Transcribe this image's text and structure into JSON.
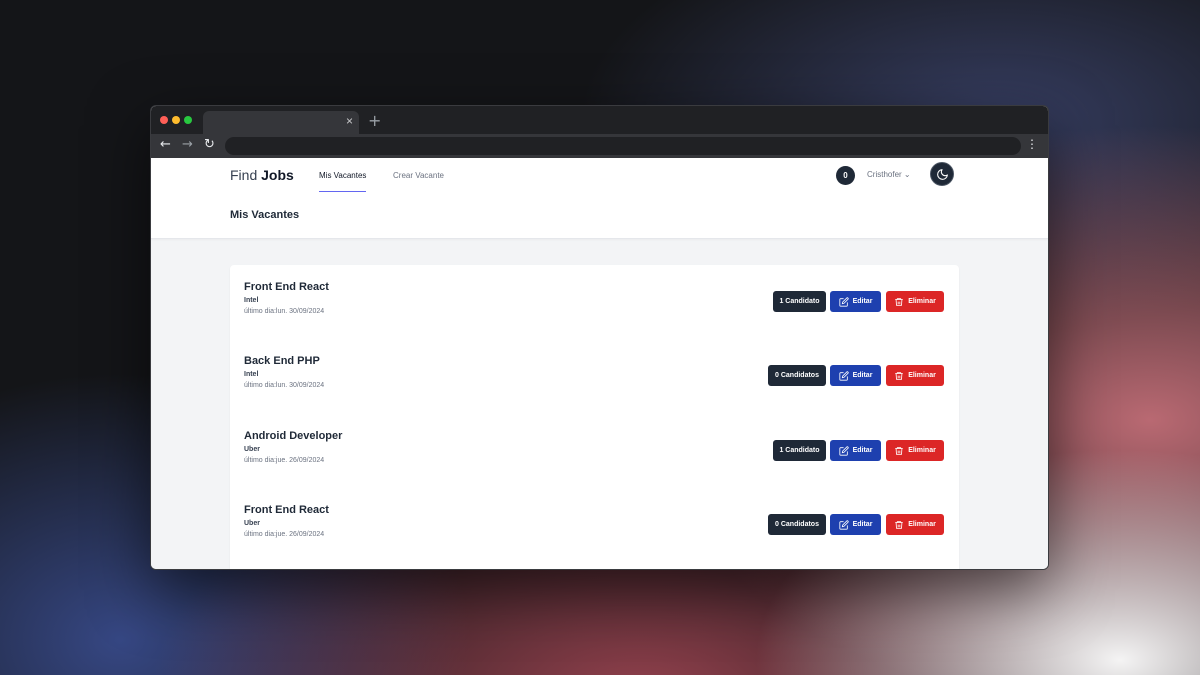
{
  "browser": {
    "tab_close": "×",
    "new_tab": "+",
    "back": "←",
    "forward": "→",
    "reload": "↻",
    "menu": "⋮"
  },
  "navbar": {
    "logo_light": "Find",
    "logo_bold": "Jobs",
    "links": [
      {
        "label": "Mis Vacantes",
        "active": true
      },
      {
        "label": "Crear Vacante",
        "active": false
      }
    ],
    "notifications_count": "0",
    "user_name": "Cristhofer",
    "user_chevron": "⌄",
    "theme_icon": "moon-icon"
  },
  "page": {
    "title": "Mis Vacantes"
  },
  "jobs": [
    {
      "title": "Front End React",
      "company": "Intel",
      "last_day": "último dia:lun. 30/09/2024",
      "candidates_label": "1 Candidato",
      "edit_label": "Editar",
      "delete_label": "Eliminar"
    },
    {
      "title": "Back End PHP",
      "company": "Intel",
      "last_day": "último dia:lun. 30/09/2024",
      "candidates_label": "0 Candidatos",
      "edit_label": "Editar",
      "delete_label": "Eliminar"
    },
    {
      "title": "Android Developer",
      "company": "Uber",
      "last_day": "último dia:jue. 26/09/2024",
      "candidates_label": "1 Candidato",
      "edit_label": "Editar",
      "delete_label": "Eliminar"
    },
    {
      "title": "Front End React",
      "company": "Uber",
      "last_day": "último dia:jue. 26/09/2024",
      "candidates_label": "0 Candidatos",
      "edit_label": "Editar",
      "delete_label": "Eliminar"
    }
  ],
  "colors": {
    "primary_dark": "#1f2937",
    "edit_blue": "#1e40af",
    "delete_red": "#dc2626",
    "active_underline": "#6366f1"
  }
}
